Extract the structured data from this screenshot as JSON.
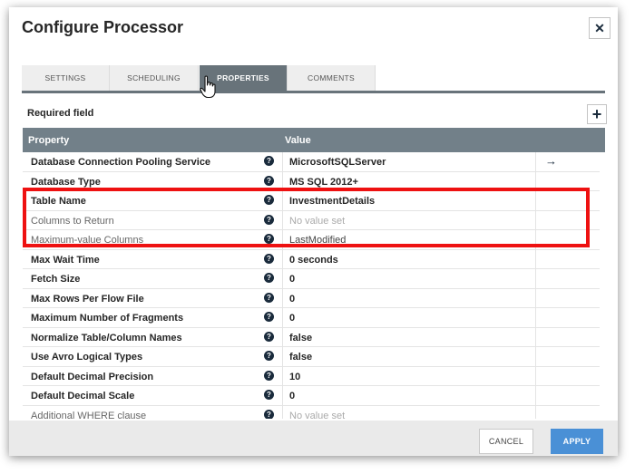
{
  "dialog": {
    "title": "Configure Processor",
    "close_symbol": "✕"
  },
  "tabs": [
    {
      "label": "SETTINGS",
      "active": false
    },
    {
      "label": "SCHEDULING",
      "active": false
    },
    {
      "label": "PROPERTIES",
      "active": true
    },
    {
      "label": "COMMENTS",
      "active": false
    }
  ],
  "required_field_label": "Required field",
  "add_symbol": "+",
  "table": {
    "headers": {
      "property": "Property",
      "value": "Value"
    },
    "rows": [
      {
        "name": "Database Connection Pooling Service",
        "value": "MicrosoftSQLServer",
        "required": true,
        "has_arrow": true
      },
      {
        "name": "Database Type",
        "value": "MS SQL 2012+",
        "required": true
      },
      {
        "name": "Table Name",
        "value": "InvestmentDetails",
        "required": true
      },
      {
        "name": "Columns to Return",
        "value": "No value set",
        "required": false,
        "empty": true
      },
      {
        "name": "Maximum-value Columns",
        "value": "LastModified",
        "required": false
      },
      {
        "name": "Max Wait Time",
        "value": "0 seconds",
        "required": true
      },
      {
        "name": "Fetch Size",
        "value": "0",
        "required": true
      },
      {
        "name": "Max Rows Per Flow File",
        "value": "0",
        "required": true
      },
      {
        "name": "Maximum Number of Fragments",
        "value": "0",
        "required": true
      },
      {
        "name": "Normalize Table/Column Names",
        "value": "false",
        "required": true
      },
      {
        "name": "Use Avro Logical Types",
        "value": "false",
        "required": true
      },
      {
        "name": "Default Decimal Precision",
        "value": "10",
        "required": true
      },
      {
        "name": "Default Decimal Scale",
        "value": "0",
        "required": true
      },
      {
        "name": "Additional WHERE clause",
        "value": "No value set",
        "required": false,
        "empty": true
      }
    ],
    "help_symbol": "?",
    "arrow_symbol": "→"
  },
  "footer": {
    "cancel_label": "CANCEL",
    "apply_label": "APPLY"
  },
  "colors": {
    "header": "#728089",
    "active_tab": "#68737a",
    "apply": "#4a90d6",
    "highlight": "#ee1111"
  }
}
